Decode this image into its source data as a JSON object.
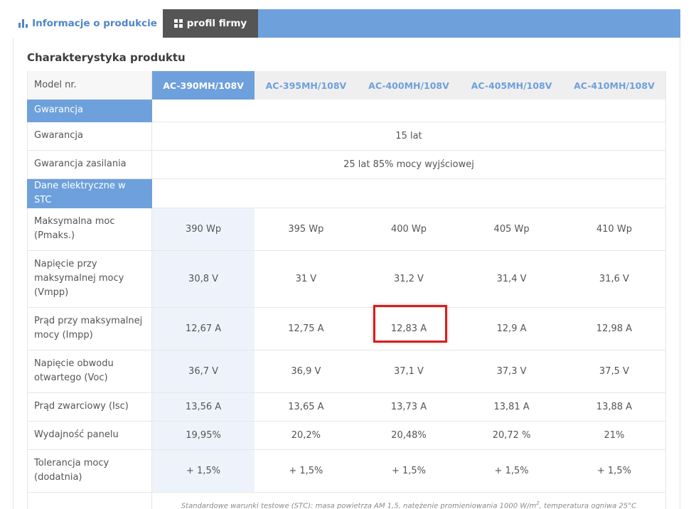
{
  "tabs": [
    {
      "label": "Informacje o produkcie",
      "icon": "bar-chart-icon",
      "active": true
    },
    {
      "label": "profil firmy",
      "icon": "grid-icon",
      "active": false
    }
  ],
  "section_title": "Charakterystyka produktu",
  "header": {
    "label": "Model nr.",
    "models": [
      "AC-390MH/108V",
      "AC-395MH/108V",
      "AC-400MH/108V",
      "AC-405MH/108V",
      "AC-410MH/108V"
    ]
  },
  "groups": {
    "warranty": "Gwarancja",
    "electrical": "Dane elektryczne w STC"
  },
  "warranty_rows": [
    {
      "label": "Gwarancja",
      "value": "15 lat"
    },
    {
      "label": "Gwarancja zasilania",
      "value": "25 lat 85% mocy wyjściowej"
    }
  ],
  "electrical_rows": [
    {
      "label": "Maksymalna moc (Pmaks.)",
      "values": [
        "390 Wp",
        "395 Wp",
        "400 Wp",
        "405 Wp",
        "410 Wp"
      ]
    },
    {
      "label": "Napięcie przy maksymalnej mocy (Vmpp)",
      "values": [
        "30,8 V",
        "31 V",
        "31,2 V",
        "31,4 V",
        "31,6 V"
      ]
    },
    {
      "label": "Prąd przy maksymalnej mocy (Impp)",
      "values": [
        "12,67 A",
        "12,75 A",
        "12,83 A",
        "12,9 A",
        "12,98 A"
      ]
    },
    {
      "label": "Napięcie obwodu otwartego (Voc)",
      "values": [
        "36,7 V",
        "36,9 V",
        "37,1 V",
        "37,3 V",
        "37,5 V"
      ]
    },
    {
      "label": "Prąd zwarciowy (Isc)",
      "values": [
        "13,56 A",
        "13,65 A",
        "13,73 A",
        "13,81 A",
        "13,88 A"
      ]
    },
    {
      "label": "Wydajność panelu",
      "values": [
        "19,95%",
        "20,2%",
        "20,48%",
        "20,72 %",
        "21%"
      ]
    },
    {
      "label": "Tolerancja mocy (dodatnia)",
      "values": [
        "+ 1,5%",
        "+ 1,5%",
        "+ 1,5%",
        "+ 1,5%",
        "+ 1,5%"
      ]
    }
  ],
  "footnote": {
    "text_before": "Standardowe warunki testowe (STC): masa powietrza AM 1,5, natężenie promieniowania 1000 W/m",
    "sup": "2",
    "text_after": ", temperatura ogniwa 25°C"
  },
  "colors": {
    "accent": "#6ea0dc",
    "dark_tab": "#555555",
    "highlight_cell": "#eef3fb",
    "callout": "#d81e1e"
  }
}
